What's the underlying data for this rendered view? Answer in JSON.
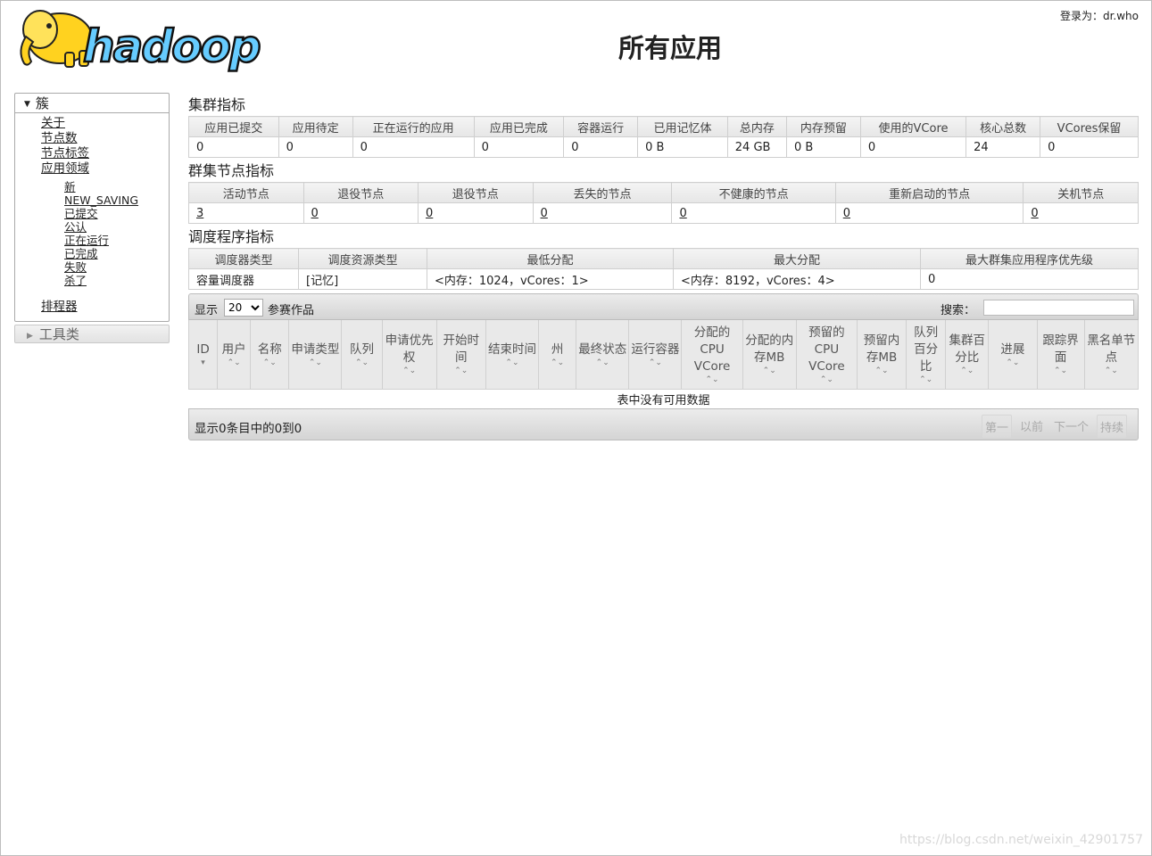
{
  "header": {
    "logo_text": "hadoop",
    "title": "所有应用",
    "login": "登录为：dr.who"
  },
  "nav": {
    "cluster": "簇",
    "links": [
      "关于",
      "节点数",
      "节点标签",
      "应用领域"
    ],
    "sub_links": [
      "新",
      "NEW_SAVING",
      "已提交",
      "公认",
      "正在运行",
      "已完成",
      "失败",
      "杀了"
    ],
    "scheduler": "排程器",
    "tools": "工具类"
  },
  "cluster_metrics": {
    "title": "集群指标",
    "headers": [
      "应用已提交",
      "应用待定",
      "正在运行的应用",
      "应用已完成",
      "容器运行",
      "已用记忆体",
      "总内存",
      "内存预留",
      "使用的VCore",
      "核心总数",
      "VCores保留"
    ],
    "values": [
      "0",
      "0",
      "0",
      "0",
      "0",
      "0 B",
      "24 GB",
      "0 B",
      "0",
      "24",
      "0"
    ]
  },
  "node_metrics": {
    "title": "群集节点指标",
    "headers": [
      "活动节点",
      "退役节点",
      "退役节点",
      "丢失的节点",
      "不健康的节点",
      "重新启动的节点",
      "关机节点"
    ],
    "values": [
      "3",
      "0",
      "0",
      "0",
      "0",
      "0",
      "0"
    ]
  },
  "scheduler_metrics": {
    "title": "调度程序指标",
    "headers": [
      "调度器类型",
      "调度资源类型",
      "最低分配",
      "最大分配",
      "最大群集应用程序优先级"
    ],
    "values": [
      "容量调度器",
      "[记忆]",
      "<内存：1024，vCores：1>",
      "<内存：8192，vCores：4>",
      "0"
    ]
  },
  "apps": {
    "show_label": "显示",
    "page_size": "20",
    "entries_label": "参赛作品",
    "search_label": "搜索：",
    "search_value": "",
    "columns": [
      "ID",
      "用户",
      "名称",
      "申请类型",
      "队列",
      "申请优先权",
      "开始时间",
      "结束时间",
      "州",
      "最终状态",
      "运行容器",
      "分配的CPU VCore",
      "分配的内存MB",
      "预留的CPU VCore",
      "预留内存MB",
      "队列百分比",
      "集群百分比",
      "进展",
      "跟踪界面",
      "黑名单节点"
    ],
    "empty_text": "表中没有可用数据",
    "info": "显示0条目中的0到0",
    "pager": [
      "第一",
      "以前",
      "下一个",
      "持续"
    ]
  },
  "watermark": "https://blog.csdn.net/weixin_42901757",
  "colors": {
    "logo_yellow": "#ffd21f",
    "logo_blue": "#66ccff",
    "header_bg": "#e9e9e9"
  }
}
